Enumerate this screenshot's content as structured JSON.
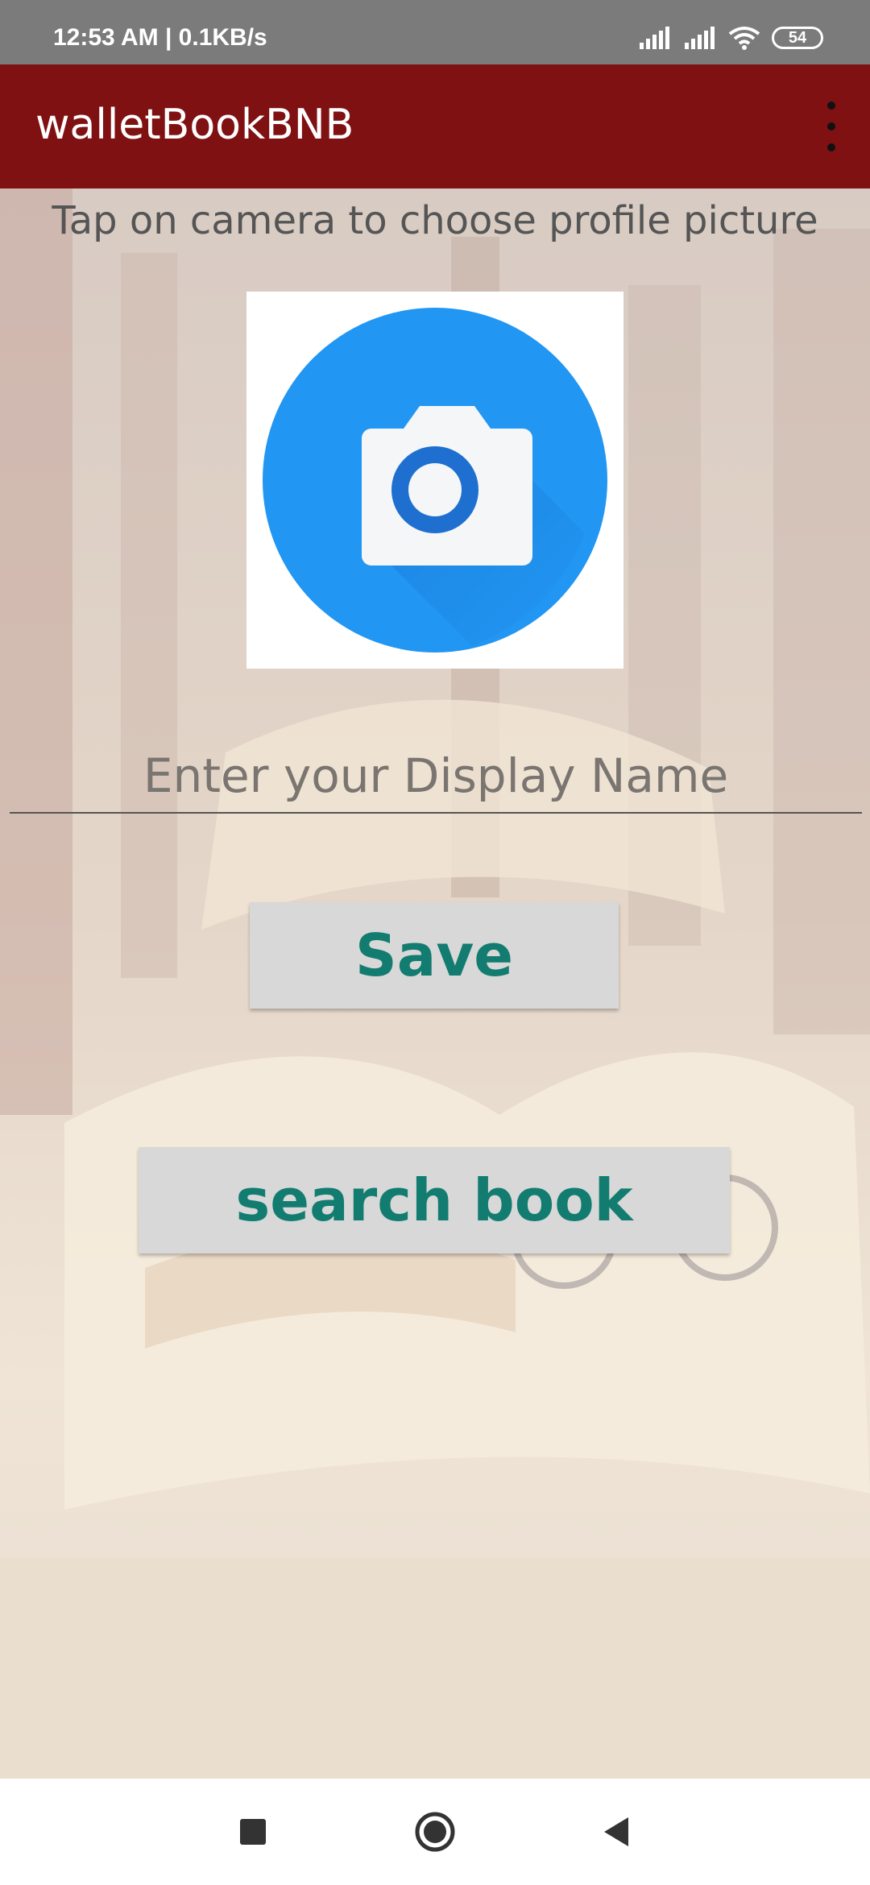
{
  "status_bar": {
    "time_network": "12:53 AM | 0.1KB/s",
    "battery": "54",
    "icons": [
      "signal-icon",
      "signal-icon",
      "wifi-icon",
      "battery-icon"
    ]
  },
  "app_bar": {
    "title": "walletBookBNB",
    "menu_icon": "overflow-menu-icon"
  },
  "main": {
    "hint_text": "Tap on camera to choose profile picture",
    "photo_icon": "camera-icon",
    "display_name": {
      "value": "",
      "placeholder": "Enter your Display Name"
    },
    "save_label": "Save",
    "search_label": "search book"
  },
  "nav_bar": {
    "icons": [
      "recent-apps-icon",
      "home-icon",
      "back-icon"
    ]
  },
  "colors": {
    "app_bar": "#801112",
    "accent_text": "#137c70",
    "button_bg": "#d7d8d7",
    "camera_blue": "#2196f3"
  }
}
